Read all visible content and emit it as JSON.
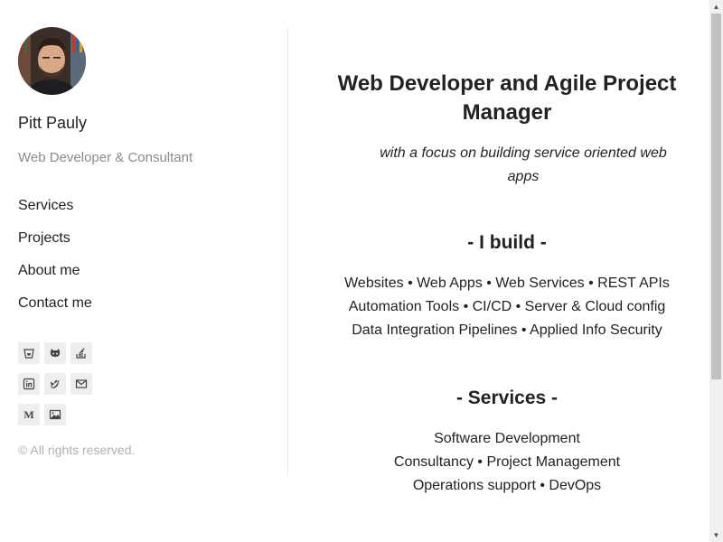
{
  "sidebar": {
    "name": "Pitt Pauly",
    "tagline": "Web Developer & Consultant",
    "nav": [
      {
        "label": "Services"
      },
      {
        "label": "Projects"
      },
      {
        "label": "About me"
      },
      {
        "label": "Contact me"
      }
    ],
    "social_rows": [
      [
        "bitbucket-icon",
        "github-icon",
        "stackoverflow-icon"
      ],
      [
        "linkedin-icon",
        "twitter-icon",
        "email-icon"
      ],
      [
        "medium-icon",
        "image-gallery-icon"
      ]
    ],
    "copyright": "© All rights reserved."
  },
  "main": {
    "headline": "Web Developer and Agile Project Manager",
    "subline": "with a focus on building service oriented web apps",
    "build": {
      "title": "- I build -",
      "lines": [
        "Websites • Web Apps • Web Services • REST APIs",
        "Automation Tools • CI/CD • Server & Cloud config",
        "Data Integration Pipelines • Applied Info Security"
      ]
    },
    "services": {
      "title": "- Services -",
      "lines": [
        "Software Development",
        "Consultancy • Project Management",
        "Operations support • DevOps"
      ]
    }
  },
  "scrollbar": {
    "up_arrow": "▲",
    "down_arrow": "▼"
  },
  "colors": {
    "text": "#222222",
    "muted": "#8a8a8a",
    "copyright": "#b0b0b0",
    "social_bg": "#eeeeee",
    "divider": "#ececec"
  }
}
